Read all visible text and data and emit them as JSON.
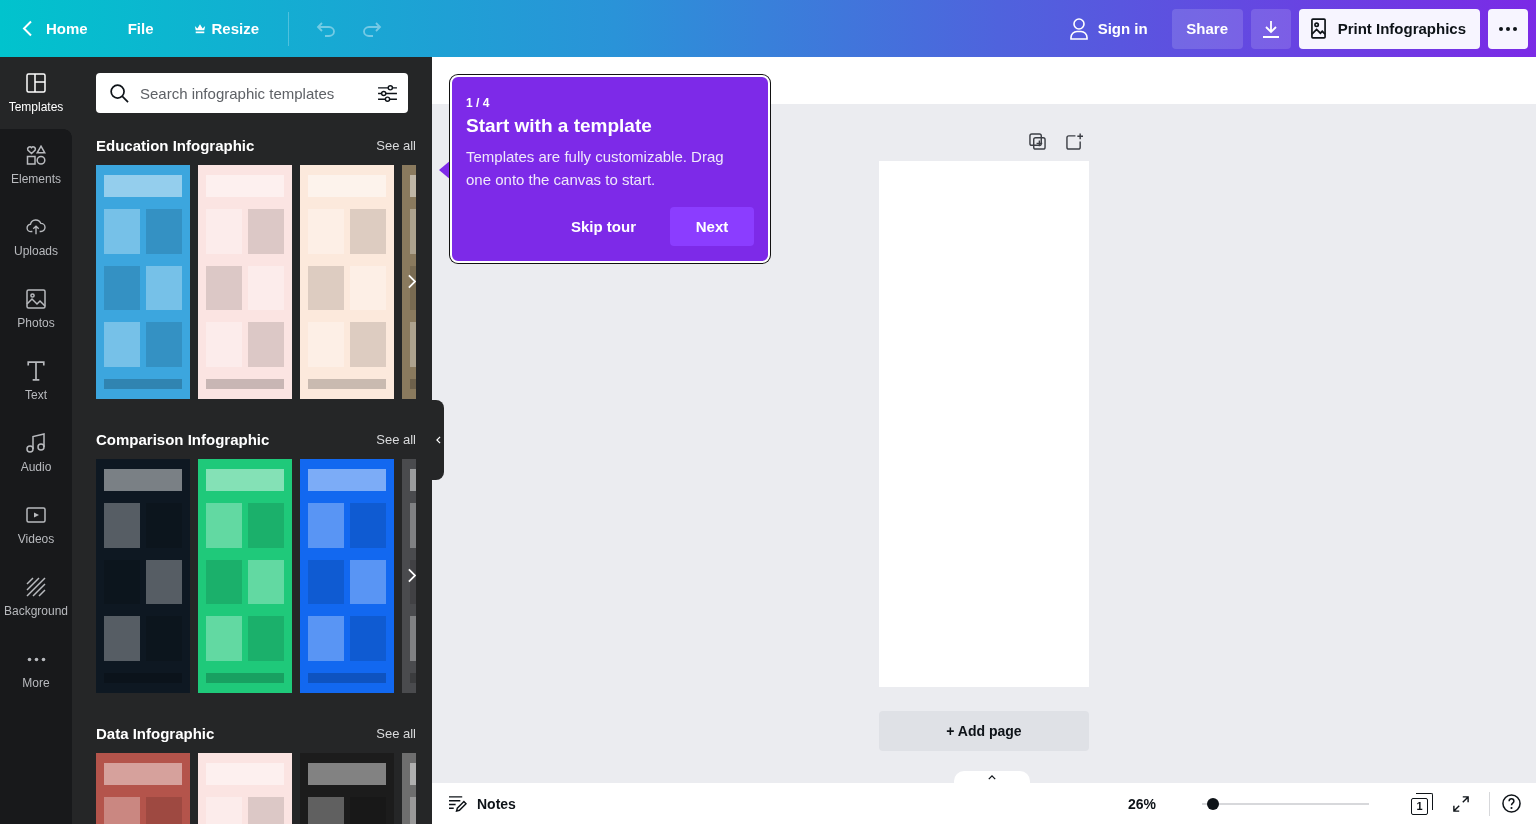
{
  "top_bar": {
    "nav": [
      {
        "label": "Home",
        "kind": "back"
      },
      {
        "label": "File",
        "kind": "menu"
      },
      {
        "label": "Resize",
        "kind": "premium"
      }
    ],
    "undo": {
      "disabled": true
    },
    "redo": {
      "disabled": true
    },
    "sign_in": "Sign in",
    "share": "Share",
    "print": "Print Infographics"
  },
  "sidebar": {
    "items": [
      {
        "label": "Templates",
        "selected": true
      },
      {
        "label": "Elements",
        "selected": false
      },
      {
        "label": "Uploads",
        "selected": false
      },
      {
        "label": "Photos",
        "selected": false
      },
      {
        "label": "Text",
        "selected": false
      },
      {
        "label": "Audio",
        "selected": false
      },
      {
        "label": "Videos",
        "selected": false
      },
      {
        "label": "Background",
        "selected": false
      },
      {
        "label": "More",
        "selected": false
      }
    ]
  },
  "panel": {
    "search": {
      "placeholder": "Search infographic templates"
    },
    "sections": [
      {
        "title": "Education Infographic",
        "see_all": "See all",
        "thumbnails": [
          {
            "color": "#3ca6de"
          },
          {
            "color": "#fbe4e2"
          },
          {
            "color": "#fce9dc"
          },
          {
            "color": "#8a7a5e"
          }
        ]
      },
      {
        "title": "Comparison Infographic",
        "see_all": "See all",
        "thumbnails": [
          {
            "color": "#0e1822"
          },
          {
            "color": "#1fc97a"
          },
          {
            "color": "#1268f0"
          },
          {
            "color": "#4a4b4e"
          }
        ]
      },
      {
        "title": "Data Infographic",
        "see_all": "See all",
        "thumbnails": [
          {
            "color": "#b4544b"
          },
          {
            "color": "#fbe4e2"
          },
          {
            "color": "#1c1c1c"
          },
          {
            "color": "#6e6e6e"
          }
        ]
      }
    ]
  },
  "tour": {
    "step": "1 / 4",
    "title": "Start with a template",
    "body": "Templates are fully customizable. Drag one onto the canvas to start.",
    "skip": "Skip tour",
    "next": "Next"
  },
  "canvas": {
    "add_page": "+ Add page"
  },
  "bottom_bar": {
    "notes": "Notes",
    "zoom": {
      "reading": "26%",
      "level": 0.03
    },
    "page_count": "1"
  }
}
